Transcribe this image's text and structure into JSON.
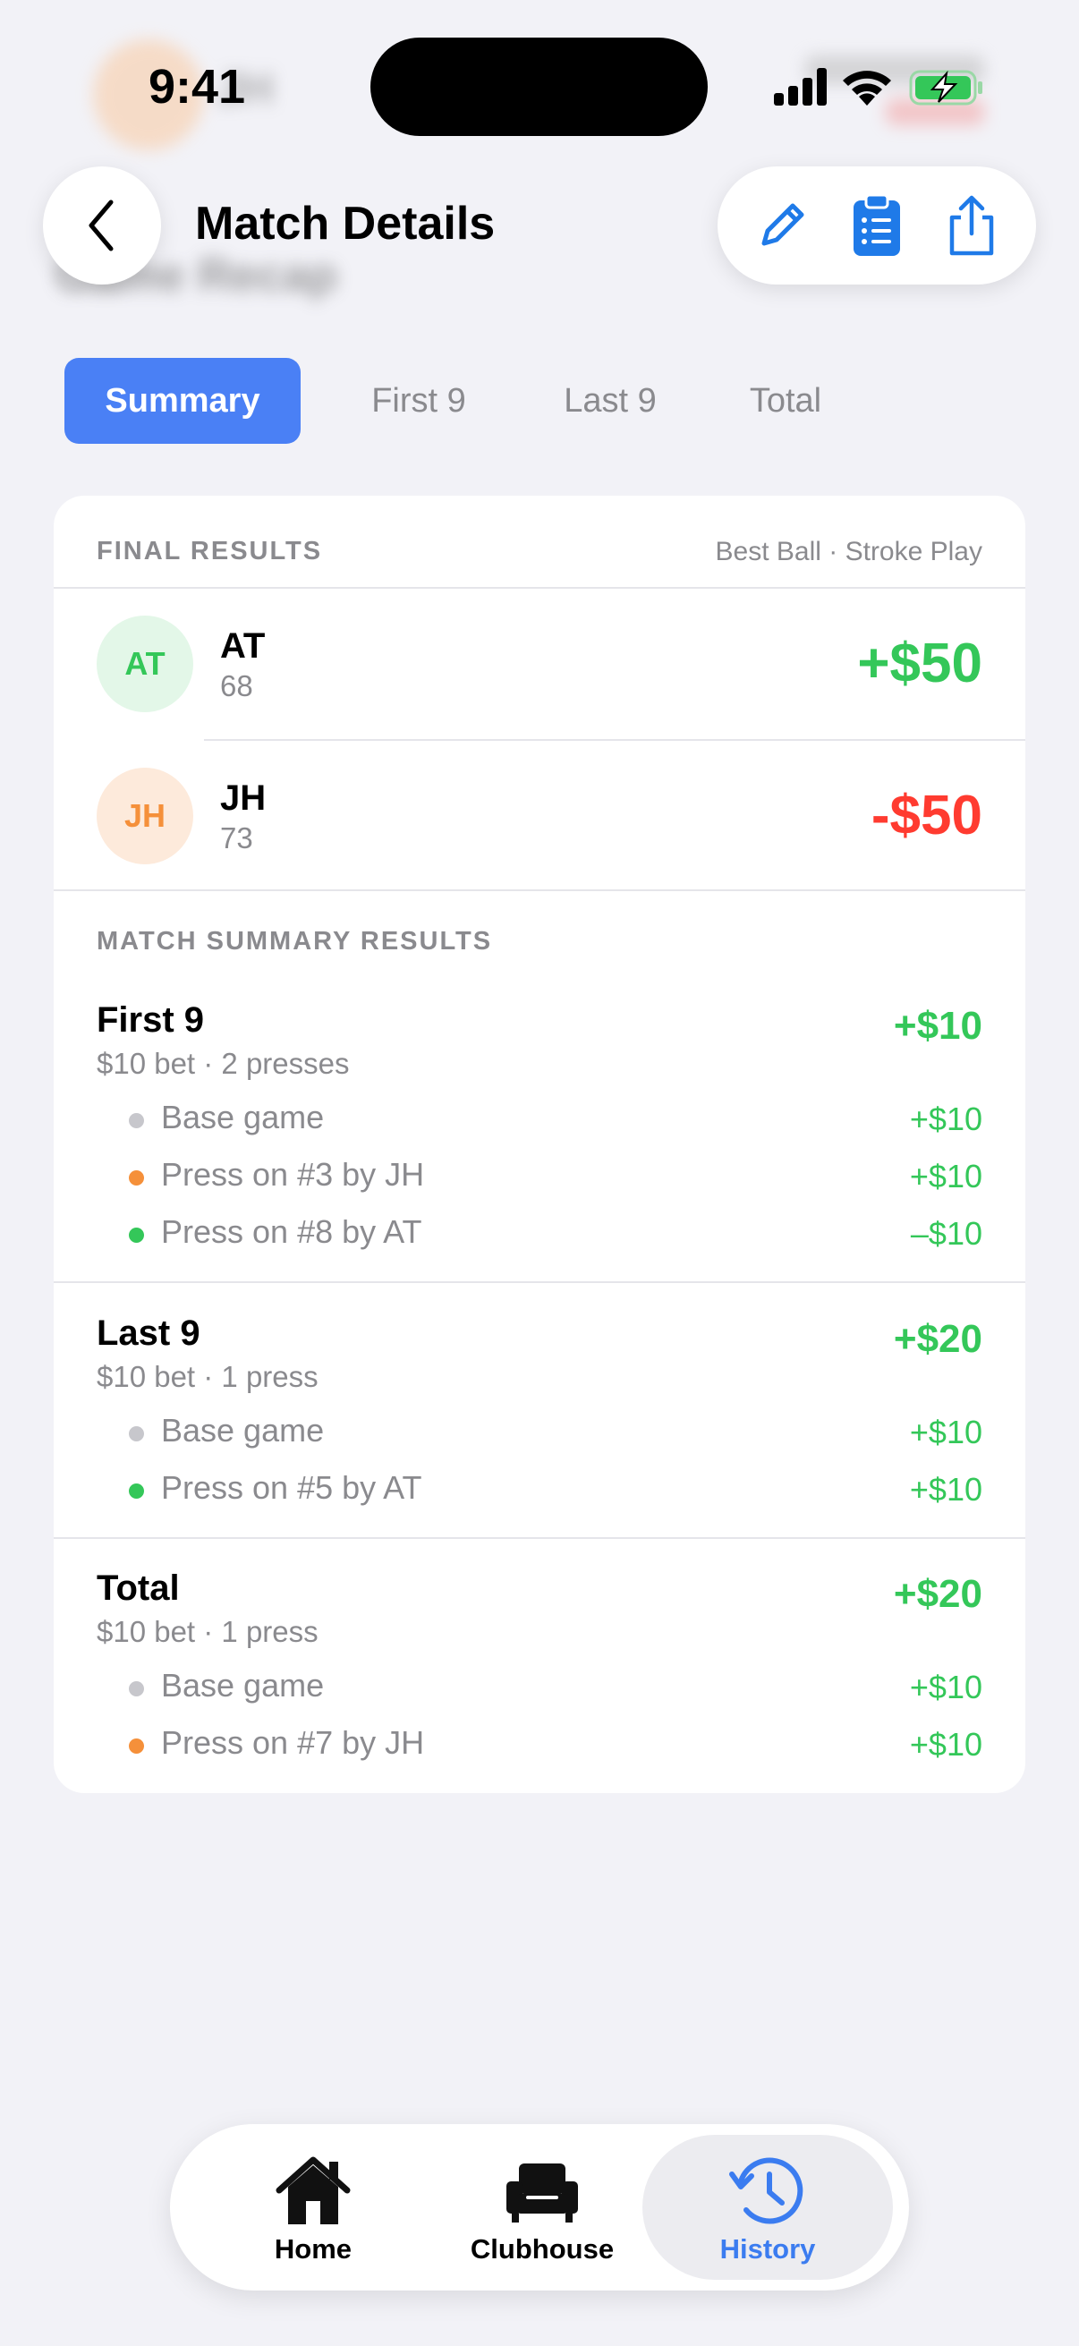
{
  "status_bar": {
    "time": "9:41"
  },
  "background_peek": {
    "initials": "JH",
    "title": "Game Recap"
  },
  "nav": {
    "title": "Match Details"
  },
  "tabs": [
    {
      "label": "Summary",
      "active": true
    },
    {
      "label": "First 9",
      "active": false
    },
    {
      "label": "Last 9",
      "active": false
    },
    {
      "label": "Total",
      "active": false
    }
  ],
  "final_results": {
    "label": "FINAL RESULTS",
    "game_type": "Best Ball · Stroke Play",
    "players": [
      {
        "initials": "AT",
        "name": "AT",
        "score": "68",
        "amount": "+$50",
        "avatar_bg": "#e3f7e8",
        "avatar_fg": "#34c759"
      },
      {
        "initials": "JH",
        "name": "JH",
        "score": "73",
        "amount": "-$50",
        "avatar_bg": "#fdeadb",
        "avatar_fg": "#f5903a"
      }
    ]
  },
  "match_summary": {
    "label": "MATCH SUMMARY RESULTS",
    "segments": [
      {
        "title": "First 9",
        "subtitle": "$10 bet · 2 presses",
        "total": "+$10",
        "items": [
          {
            "label": "Base game",
            "value": "+$10",
            "dot": "#c7c7cc"
          },
          {
            "label": "Press on #3 by JH",
            "value": "+$10",
            "dot": "#f5903a"
          },
          {
            "label": "Press on #8 by AT",
            "value": "–$10",
            "dot": "#34c759"
          }
        ]
      },
      {
        "title": "Last 9",
        "subtitle": "$10 bet · 1 press",
        "total": "+$20",
        "items": [
          {
            "label": "Base game",
            "value": "+$10",
            "dot": "#c7c7cc"
          },
          {
            "label": "Press on #5 by AT",
            "value": "+$10",
            "dot": "#34c759"
          }
        ]
      },
      {
        "title": "Total",
        "subtitle": "$10 bet · 1 press",
        "total": "+$20",
        "items": [
          {
            "label": "Base game",
            "value": "+$10",
            "dot": "#c7c7cc"
          },
          {
            "label": "Press on #7 by JH",
            "value": "+$10",
            "dot": "#f5903a"
          }
        ]
      }
    ]
  },
  "tab_bar": [
    {
      "label": "Home",
      "icon": "house-icon",
      "selected": false
    },
    {
      "label": "Clubhouse",
      "icon": "armchair-icon",
      "selected": false
    },
    {
      "label": "History",
      "icon": "clock-history-icon",
      "selected": true
    }
  ],
  "colors": {
    "accent": "#4a80f5",
    "positive": "#34c759",
    "negative": "#ff3b30",
    "muted": "#8a8a8e"
  }
}
